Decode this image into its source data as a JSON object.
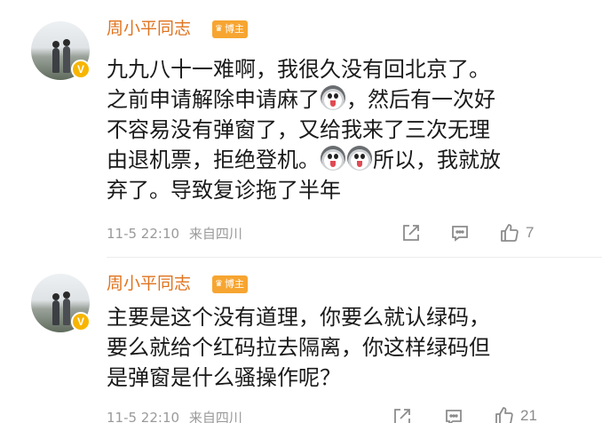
{
  "comments": [
    {
      "author": "周小平同志",
      "badge": "博主",
      "lines": [
        "九九八十一难啊，我很久没有回北京了。",
        "之前申请解除申请麻了",
        "，然后有一次好",
        "不容易没有弹窗了，又给我来了三次无理",
        "由退机票，拒绝登机。",
        "所以，我就放",
        "弃了。导致复诊拖了半年"
      ],
      "timestamp": "11-5 22:10",
      "source": "来自四川",
      "likes": "7"
    },
    {
      "author": "周小平同志",
      "badge": "博主",
      "lines": [
        "主要是这个没有道理，你要么就认绿码，",
        "要么就给个红码拉去隔离，你这样绿码但",
        "是弹窗是什么骚操作呢？"
      ],
      "timestamp": "11-5 22:10",
      "source": "来自四川",
      "likes": "21"
    }
  ],
  "icons": {
    "verified": "verified-v-badge-icon",
    "share": "share-icon",
    "reply": "comment-icon",
    "like": "thumbs-up-icon",
    "emoji": "doge-face-emoji"
  },
  "colors": {
    "author": "#e0731e",
    "badge_bg": "#f7a531",
    "verified_bg": "#f7b500",
    "meta": "#9a9a9a"
  }
}
